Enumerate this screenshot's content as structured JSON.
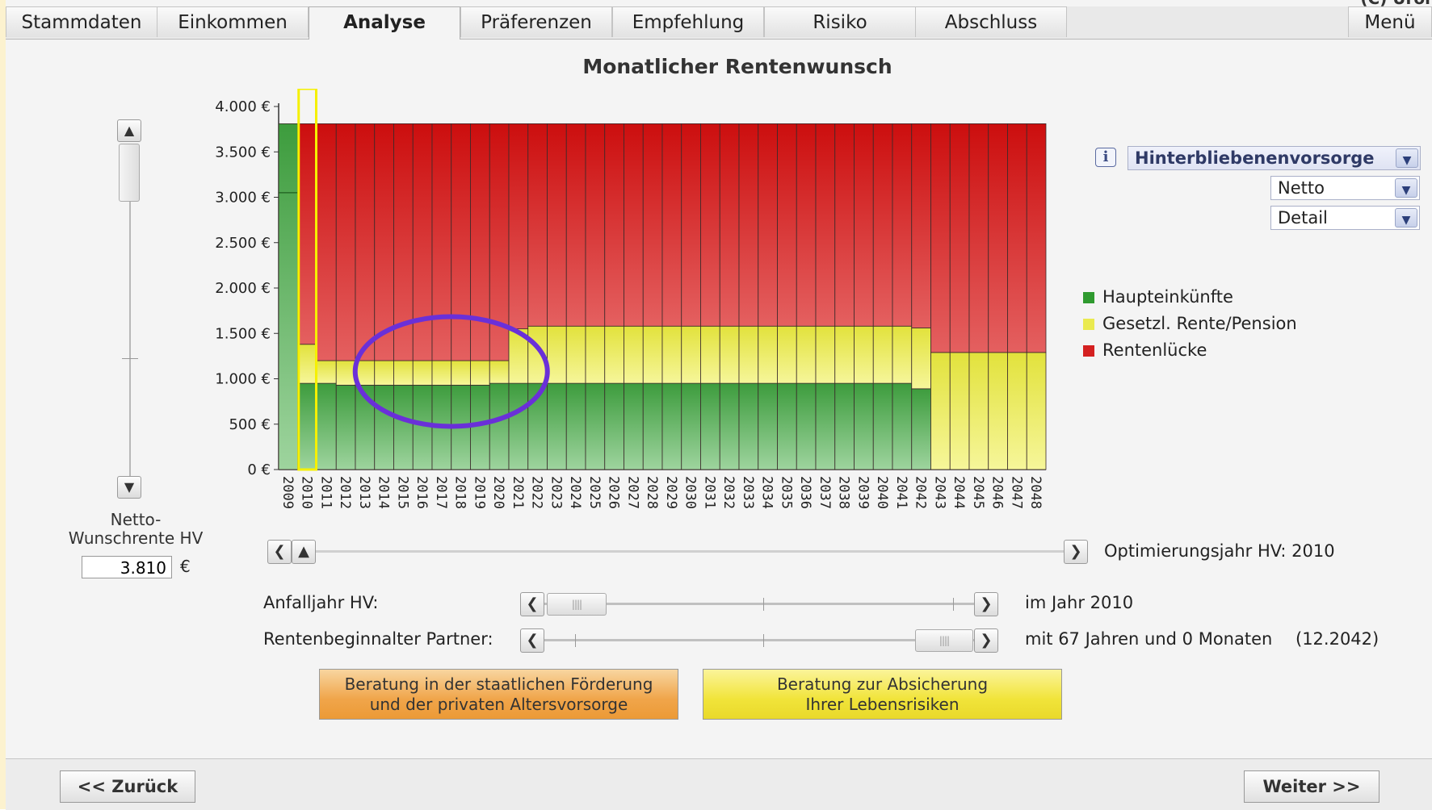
{
  "corner_text": "(C) Urol",
  "tabs": [
    "Stammdaten",
    "Einkommen",
    "Analyse",
    "Präferenzen",
    "Empfehlung",
    "Risiko",
    "Abschluss"
  ],
  "active_tab": "Analyse",
  "menu_label": "Menü",
  "left_panel": {
    "label_line1": "Netto-",
    "label_line2": "Wunschrente HV",
    "value": "3.810",
    "unit": "€"
  },
  "right_panel": {
    "info_icon": "i",
    "select_hv": "Hinterbliebenenvorsorge",
    "select_netto": "Netto",
    "select_detail": "Detail"
  },
  "optimization_label": "Optimierungsjahr HV: 2010",
  "sliders": {
    "anfalljahr_label": "Anfalljahr HV:",
    "anfalljahr_value": "im Jahr 2010",
    "rentenbeginn_label": "Rentenbeginnalter Partner:",
    "rentenbeginn_value": "mit 67 Jahren und 0 Monaten",
    "rentenbeginn_date": "(12.2042)"
  },
  "buttons": {
    "orange_line1": "Beratung in der staatlichen Förderung",
    "orange_line2": "und der privaten Altersvorsorge",
    "yellow_line1": "Beratung zur Absicherung",
    "yellow_line2": "Ihrer Lebensrisiken",
    "back": "<< Zurück",
    "next": "Weiter >>"
  },
  "colors": {
    "haupteinkuenfte": "#2f9a2f",
    "rente": "#eaea50",
    "luecke": "#d42020",
    "highlight": "#f5f000",
    "annotation": "#6a30d8"
  },
  "chart_data": {
    "type": "bar",
    "stacked": true,
    "title": "Monatlicher Rentenwunsch",
    "yunit": "€",
    "ylim": [
      0,
      4000
    ],
    "yticks": [
      "0 €",
      "500 €",
      "1.000 €",
      "1.500 €",
      "2.000 €",
      "2.500 €",
      "3.000 €",
      "3.500 €",
      "4.000 €"
    ],
    "categories": [
      "2009",
      "2010",
      "2011",
      "2012",
      "2013",
      "2014",
      "2015",
      "2016",
      "2017",
      "2018",
      "2019",
      "2020",
      "2021",
      "2022",
      "2023",
      "2024",
      "2025",
      "2026",
      "2027",
      "2028",
      "2029",
      "2030",
      "2031",
      "2032",
      "2033",
      "2034",
      "2035",
      "2036",
      "2037",
      "2038",
      "2039",
      "2040",
      "2041",
      "2042",
      "2043",
      "2044",
      "2045",
      "2046",
      "2047",
      "2048"
    ],
    "series": [
      {
        "name": "Haupteinkünfte",
        "values": [
          3810,
          950,
          950,
          930,
          930,
          930,
          930,
          930,
          930,
          930,
          930,
          950,
          950,
          950,
          950,
          950,
          950,
          950,
          950,
          950,
          950,
          950,
          950,
          950,
          950,
          950,
          950,
          950,
          950,
          950,
          950,
          950,
          950,
          890,
          0,
          0,
          0,
          0,
          0,
          0
        ]
      },
      {
        "name": "Gesetzl. Rente/Pension",
        "values": [
          0,
          430,
          250,
          270,
          270,
          270,
          270,
          270,
          270,
          270,
          270,
          250,
          600,
          630,
          630,
          630,
          630,
          630,
          630,
          630,
          630,
          630,
          630,
          630,
          630,
          630,
          630,
          630,
          630,
          630,
          630,
          630,
          630,
          670,
          1290,
          1290,
          1290,
          1290,
          1290,
          1290
        ]
      },
      {
        "name": "Rentenlücke",
        "values": [
          0,
          2430,
          2610,
          2610,
          2610,
          2610,
          2610,
          2610,
          2610,
          2610,
          2610,
          2610,
          2260,
          2230,
          2230,
          2230,
          2230,
          2230,
          2230,
          2230,
          2230,
          2230,
          2230,
          2230,
          2230,
          2230,
          2230,
          2230,
          2230,
          2230,
          2230,
          2230,
          2230,
          2250,
          2520,
          2520,
          2520,
          2520,
          2520,
          2520
        ]
      }
    ],
    "reference_line": 3810,
    "marker_2009": 3050,
    "highlighted_category": "2010",
    "legend_position": "right"
  }
}
